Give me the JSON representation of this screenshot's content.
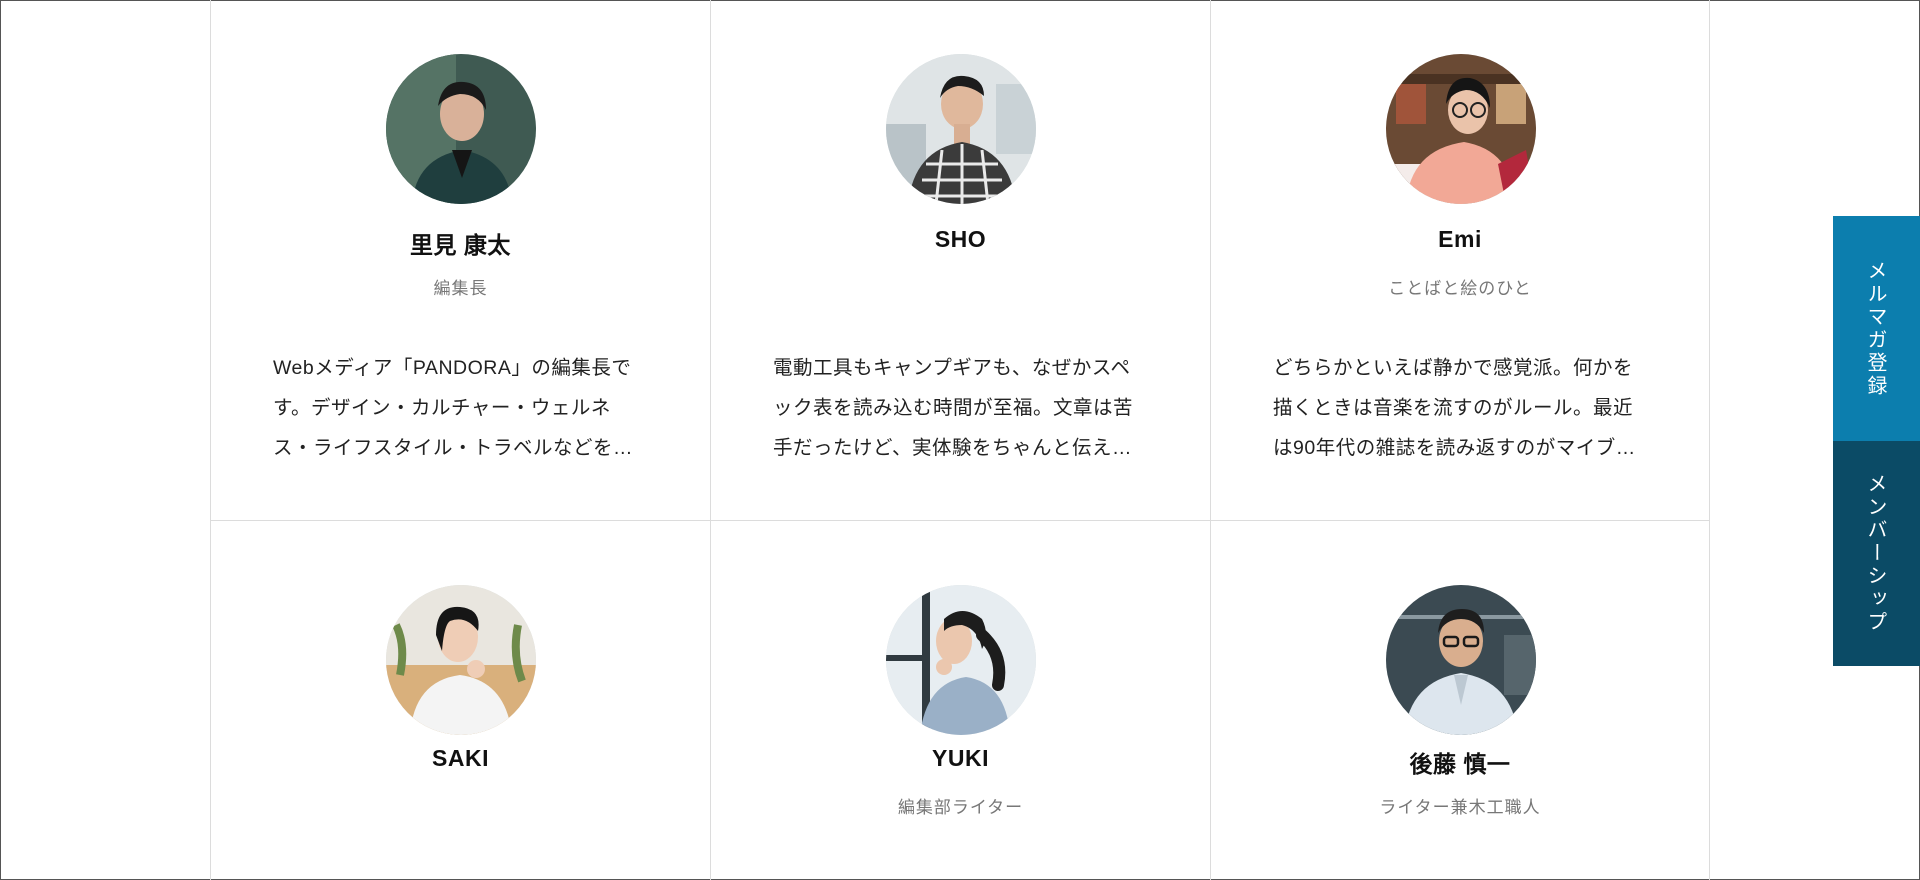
{
  "members": [
    {
      "name": "里見 康太",
      "role": "編集長",
      "bio": [
        "Webメディア「PANDORA」の編集長で",
        "す。デザイン・カルチャー・ウェルネ",
        "ス・ライフスタイル・トラベルなどを…"
      ]
    },
    {
      "name": "SHO",
      "role": "",
      "bio": [
        "電動工具もキャンプギアも、なぜかスペ",
        "ック表を読み込む時間が至福。文章は苦",
        "手だったけど、実体験をちゃんと伝え…"
      ]
    },
    {
      "name": "Emi",
      "role": "ことばと絵のひと",
      "bio": [
        "どちらかといえば静かで感覚派。何かを",
        "描くときは音楽を流すのがルール。最近",
        "は90年代の雑誌を読み返すのがマイブ…"
      ]
    },
    {
      "name": "SAKI",
      "role": ""
    },
    {
      "name": "YUKI",
      "role": "編集部ライター"
    },
    {
      "name": "後藤 慎一",
      "role": "ライター兼木工職人"
    }
  ],
  "side_buttons": {
    "newsletter": "メルマガ登録",
    "membership": "メンバーシップ"
  },
  "colors": {
    "newsletter_bg": "#0c7eae",
    "membership_bg": "#0b4b66",
    "divider": "#dcdcdc"
  }
}
